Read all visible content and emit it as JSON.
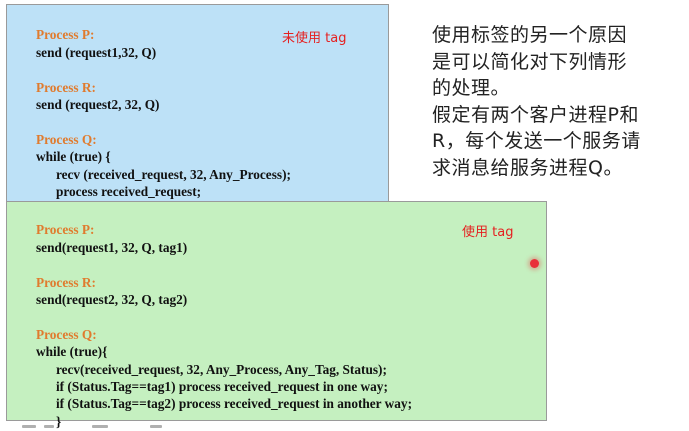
{
  "untagged_panel": {
    "note": "未使用 tag",
    "blocks": [
      {
        "header": "Process P:",
        "lines": [
          "send (request1,32, Q)"
        ]
      },
      {
        "header": "Process R:",
        "lines": [
          "send (request2, 32, Q)"
        ]
      },
      {
        "header": "Process Q:",
        "lines": [
          "while (true) {",
          "      recv (received_request, 32, Any_Process);",
          "      process received_request;",
          "      }"
        ]
      }
    ]
  },
  "tagged_panel": {
    "note": "使用 tag",
    "blocks": [
      {
        "header": "Process P:",
        "lines": [
          "send(request1, 32, Q, tag1)"
        ]
      },
      {
        "header": "Process R:",
        "lines": [
          "send(request2, 32, Q, tag2)"
        ]
      },
      {
        "header": "Process Q:",
        "lines": [
          "while (true){",
          "      recv(received_request, 32, Any_Process, Any_Tag, Status);",
          "      if (Status.Tag==tag1) process received_request in one way;",
          "      if (Status.Tag==tag2) process received_request in another way;",
          "      }"
        ]
      }
    ]
  },
  "explanation": {
    "lines": [
      "使用标签的另一个原因",
      "是可以简化对下列情形",
      "的处理。",
      "假定有两个客户进程P和",
      "R，每个发送一个服务请",
      "求消息给服务进程Q。"
    ]
  },
  "colors": {
    "blue_panel": "#bde1f7",
    "green_panel": "#c5f0c0",
    "process_header": "#e07b2e",
    "note_red": "#e52020",
    "pointer_dot": "#e8303a"
  }
}
